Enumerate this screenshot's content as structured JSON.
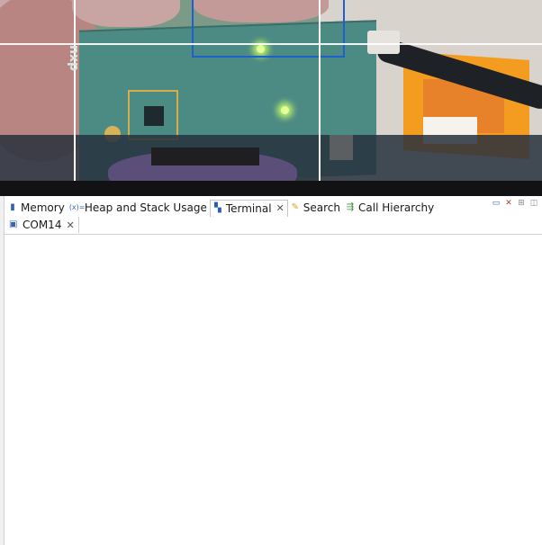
{
  "tabs": [
    {
      "label": "Memory",
      "icon": "memory-icon"
    },
    {
      "label": "Heap and Stack Usage",
      "icon": "heap-icon"
    },
    {
      "label": "Terminal",
      "icon": "terminal-icon",
      "active": true
    },
    {
      "label": "Search",
      "icon": "search-icon"
    },
    {
      "label": "Call Hierarchy",
      "icon": "call-hierarchy-icon"
    }
  ],
  "subtab": {
    "label": "COM14",
    "icon": "serial-port-icon"
  },
  "photo": {
    "board_logo": "nxp"
  },
  "colors": {
    "panel_bg": "#ffffff",
    "divider": "#121215",
    "overlay_rect": "#1f5fd0"
  }
}
